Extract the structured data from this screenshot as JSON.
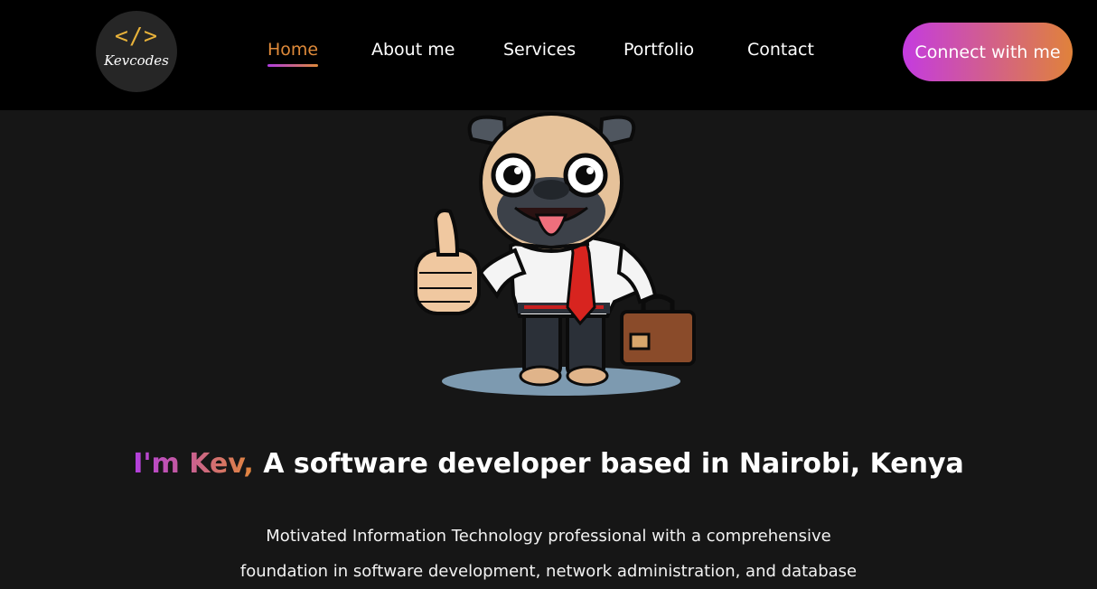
{
  "brand": {
    "symbol": "</>",
    "name": "Kevcodes"
  },
  "nav": {
    "items": [
      {
        "label": "Home",
        "active": true
      },
      {
        "label": "About me",
        "active": false
      },
      {
        "label": "Services",
        "active": false
      },
      {
        "label": "Portfolio",
        "active": false
      },
      {
        "label": "Contact",
        "active": false
      }
    ],
    "cta_label": "Connect with me"
  },
  "hero": {
    "greeting": "I'm Kev,",
    "headline": "A software developer based in Nairobi, Kenya",
    "bio_lines": [
      "Motivated Information Technology professional with a comprehensive",
      "foundation in software development, network administration, and database"
    ]
  },
  "colors": {
    "background": "#161616",
    "navbar": "#000000",
    "accent_purple": "#c43be0",
    "accent_orange": "#e0823a",
    "logo_symbol": "#e8b23a"
  },
  "icons": [
    "code-brackets-logo",
    "pug-mascot-illustration"
  ]
}
